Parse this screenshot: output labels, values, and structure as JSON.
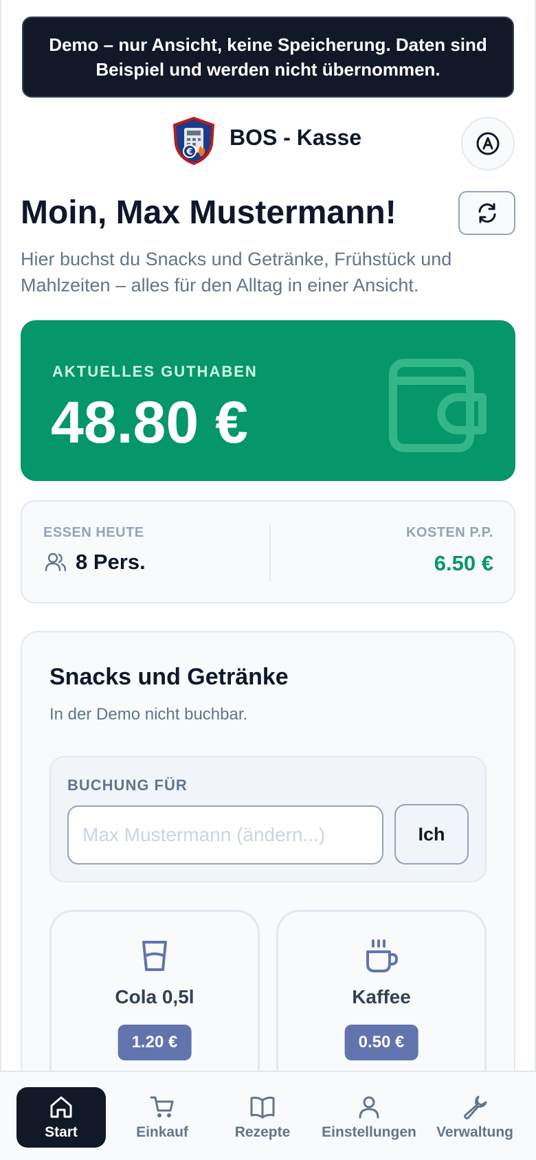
{
  "banner": {
    "text": "Demo – nur Ansicht, keine Speicherung. Daten sind Beispiel und werden nicht übernommen."
  },
  "header": {
    "app_title": "BOS - Kasse",
    "profile_icon": "user-circle-icon"
  },
  "main": {
    "greeting": "Moin, Max Mustermann!",
    "refresh_icon": "refresh-icon",
    "subtitle": "Hier buchst du Snacks und Getränke, Frühstück und Mahlzeiten – alles für den Alltag in einer Ansicht."
  },
  "balance": {
    "label": "AKTUELLES GUTHABEN",
    "value": "48.80 €",
    "icon": "wallet-icon",
    "color": "#059669"
  },
  "stats": {
    "meals_label": "ESSEN HEUTE",
    "persons": "8 Pers.",
    "cost_label": "KOSTEN P.P.",
    "cost_value": "6.50 €"
  },
  "snacks": {
    "title": "Snacks und Getränke",
    "note": "In der Demo nicht buchbar.",
    "booking_label": "BUCHUNG FÜR",
    "booking_placeholder": "Max Mustermann (ändern...)",
    "me_button": "Ich",
    "products": [
      {
        "name": "Cola 0,5l",
        "price": "1.20 €",
        "icon": "glass-icon"
      },
      {
        "name": "Kaffee",
        "price": "0.50 €",
        "icon": "coffee-cup-icon"
      }
    ]
  },
  "nav": {
    "items": [
      {
        "label": "Start",
        "icon": "home-icon",
        "active": true
      },
      {
        "label": "Einkauf",
        "icon": "cart-icon"
      },
      {
        "label": "Rezepte",
        "icon": "book-icon"
      },
      {
        "label": "Einstellungen",
        "icon": "user-icon"
      },
      {
        "label": "Verwaltung",
        "icon": "wrench-icon"
      }
    ]
  }
}
